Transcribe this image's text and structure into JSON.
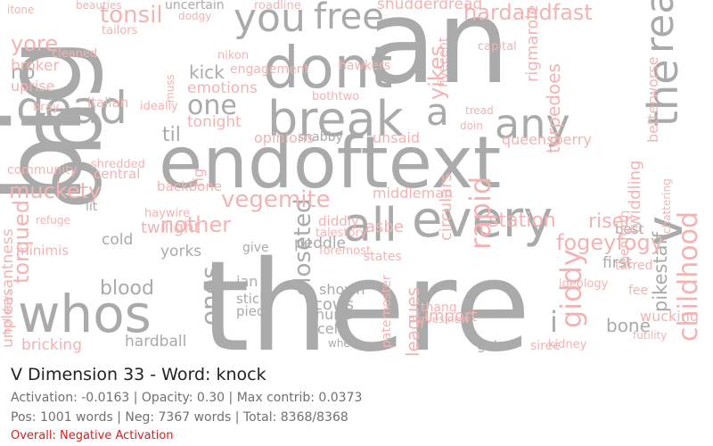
{
  "colors": {
    "positive": "#aaaaaa",
    "negative": "#f4b3b3",
    "overall": "#dd1c1c"
  },
  "info": {
    "title": "V Dimension 33 - Word: knock",
    "activation_line": "Activation: -0.0163 | Opacity: 0.30 | Max contrib: 0.0373",
    "counts_line": "Pos: 1001 words | Neg: 7367 words | Total: 8368/8368",
    "overall_line": "Overall: Negative Activation"
  },
  "wordcloud": {
    "words": [
      {
        "text": "there",
        "kind": "positive"
      },
      {
        "text": "an",
        "kind": "positive"
      },
      {
        "text": "big",
        "kind": "positive"
      },
      {
        "text": "go",
        "kind": "positive"
      },
      {
        "text": "endoftext",
        "kind": "positive"
      },
      {
        "text": "dont",
        "kind": "positive"
      },
      {
        "text": "whos",
        "kind": "positive"
      },
      {
        "text": "every",
        "kind": "positive"
      },
      {
        "text": "all",
        "kind": "positive"
      },
      {
        "text": "dead",
        "kind": "positive"
      },
      {
        "text": "break",
        "kind": "positive"
      },
      {
        "text": "any",
        "kind": "positive"
      },
      {
        "text": "a",
        "kind": "positive"
      },
      {
        "text": "you",
        "kind": "positive"
      },
      {
        "text": "free",
        "kind": "positive"
      },
      {
        "text": "the",
        "kind": "positive"
      },
      {
        "text": "v",
        "kind": "positive"
      },
      {
        "text": "read",
        "kind": "positive"
      },
      {
        "text": "blood",
        "kind": "positive"
      },
      {
        "text": "closeted",
        "kind": "positive"
      },
      {
        "text": "kick",
        "kind": "positive"
      },
      {
        "text": "one",
        "kind": "positive"
      },
      {
        "text": "ones",
        "kind": "positive"
      },
      {
        "text": "i",
        "kind": "positive"
      },
      {
        "text": "no",
        "kind": "positive"
      },
      {
        "text": "til",
        "kind": "positive"
      },
      {
        "text": "cows",
        "kind": "positive"
      },
      {
        "text": "hardball",
        "kind": "positive"
      },
      {
        "text": "hurts",
        "kind": "positive"
      },
      {
        "text": "cells",
        "kind": "positive"
      },
      {
        "text": "shown",
        "kind": "positive"
      },
      {
        "text": "peddle",
        "kind": "positive"
      },
      {
        "text": "bone",
        "kind": "positive"
      },
      {
        "text": "jan",
        "kind": "positive"
      },
      {
        "text": "stick",
        "kind": "positive"
      },
      {
        "text": "piece",
        "kind": "positive"
      },
      {
        "text": "cold",
        "kind": "positive"
      },
      {
        "text": "lit",
        "kind": "positive"
      },
      {
        "text": "get",
        "kind": "positive"
      },
      {
        "text": "give",
        "kind": "positive"
      },
      {
        "text": "yorks",
        "kind": "positive"
      },
      {
        "text": "first",
        "kind": "positive"
      },
      {
        "text": "best",
        "kind": "positive"
      },
      {
        "text": "shabby",
        "kind": "positive"
      },
      {
        "text": "uncertain",
        "kind": "positive"
      },
      {
        "text": "wheat",
        "kind": "positive"
      },
      {
        "text": "pikestaff",
        "kind": "positive"
      },
      {
        "text": "childhood",
        "kind": "negative"
      },
      {
        "text": "tonsil",
        "kind": "negative"
      },
      {
        "text": "hardandfast",
        "kind": "negative"
      },
      {
        "text": "vegemite",
        "kind": "negative"
      },
      {
        "text": "muckety",
        "kind": "negative"
      },
      {
        "text": "torqued",
        "kind": "negative"
      },
      {
        "text": "yore",
        "kind": "negative"
      },
      {
        "text": "rapid",
        "kind": "negative"
      },
      {
        "text": "giddy",
        "kind": "negative"
      },
      {
        "text": "nother",
        "kind": "negative"
      },
      {
        "text": "yikes",
        "kind": "negative"
      },
      {
        "text": "fogeyfogy",
        "kind": "negative"
      },
      {
        "text": "unpleasantness",
        "kind": "negative"
      },
      {
        "text": "import",
        "kind": "negative"
      },
      {
        "text": "asbe",
        "kind": "negative"
      },
      {
        "text": "riser",
        "kind": "negative"
      },
      {
        "text": "station",
        "kind": "negative"
      },
      {
        "text": "unsaid",
        "kind": "negative"
      },
      {
        "text": "opinions",
        "kind": "negative"
      },
      {
        "text": "twilight",
        "kind": "negative"
      },
      {
        "text": "bricking",
        "kind": "negative"
      },
      {
        "text": "leagues",
        "kind": "negative"
      },
      {
        "text": "circulars",
        "kind": "negative"
      },
      {
        "text": "torpedoes",
        "kind": "negative"
      },
      {
        "text": "rigmarole",
        "kind": "negative"
      },
      {
        "text": "twiddling",
        "kind": "negative"
      },
      {
        "text": "shudderdread",
        "kind": "negative"
      },
      {
        "text": "queensberry",
        "kind": "negative"
      },
      {
        "text": "middleman",
        "kind": "negative"
      },
      {
        "text": "tonight",
        "kind": "negative"
      },
      {
        "text": "emotions",
        "kind": "negative"
      },
      {
        "text": "backbone",
        "kind": "negative"
      },
      {
        "text": "community",
        "kind": "negative"
      },
      {
        "text": "wucking",
        "kind": "negative"
      },
      {
        "text": "minimis",
        "kind": "negative"
      },
      {
        "text": "uprise",
        "kind": "negative"
      },
      {
        "text": "broker",
        "kind": "negative"
      },
      {
        "text": "engagement",
        "kind": "negative"
      },
      {
        "text": "fee",
        "kind": "negative"
      },
      {
        "text": "states",
        "kind": "negative"
      },
      {
        "text": "ideology",
        "kind": "negative"
      },
      {
        "text": "hawkers",
        "kind": "negative"
      },
      {
        "text": "italian",
        "kind": "negative"
      },
      {
        "text": "bothtwo",
        "kind": "negative"
      },
      {
        "text": "kidney",
        "kind": "negative"
      },
      {
        "text": "betterworse",
        "kind": "negative"
      },
      {
        "text": "refuge",
        "kind": "negative"
      },
      {
        "text": "nikon",
        "kind": "negative"
      },
      {
        "text": "central",
        "kind": "negative"
      },
      {
        "text": "diddly",
        "kind": "negative"
      },
      {
        "text": "talestory",
        "kind": "negative"
      },
      {
        "text": "foremost",
        "kind": "negative"
      },
      {
        "text": "thang",
        "kind": "negative"
      },
      {
        "text": "paternoster",
        "kind": "negative"
      },
      {
        "text": "siree",
        "kind": "negative"
      },
      {
        "text": "tailors",
        "kind": "negative"
      },
      {
        "text": "roadline",
        "kind": "negative"
      },
      {
        "text": "cleaned",
        "kind": "negative"
      },
      {
        "text": "itone",
        "kind": "negative"
      },
      {
        "text": "ideally",
        "kind": "negative"
      },
      {
        "text": "shredded",
        "kind": "negative"
      },
      {
        "text": "haywire",
        "kind": "negative"
      },
      {
        "text": "capital",
        "kind": "negative"
      },
      {
        "text": "fivecent",
        "kind": "negative"
      },
      {
        "text": "penrorth",
        "kind": "negative"
      },
      {
        "text": "tarred",
        "kind": "negative"
      },
      {
        "text": "dodgy",
        "kind": "negative"
      },
      {
        "text": "muss",
        "kind": "negative"
      },
      {
        "text": "bray",
        "kind": "negative"
      },
      {
        "text": "rig",
        "kind": "negative"
      },
      {
        "text": "futility",
        "kind": "negative"
      },
      {
        "text": "holidays",
        "kind": "negative"
      },
      {
        "text": "nervesinew",
        "kind": "negative"
      },
      {
        "text": "beauties",
        "kind": "negative"
      },
      {
        "text": "chattering",
        "kind": "negative"
      },
      {
        "text": "doin",
        "kind": "negative"
      },
      {
        "text": "tread",
        "kind": "negative"
      }
    ]
  }
}
